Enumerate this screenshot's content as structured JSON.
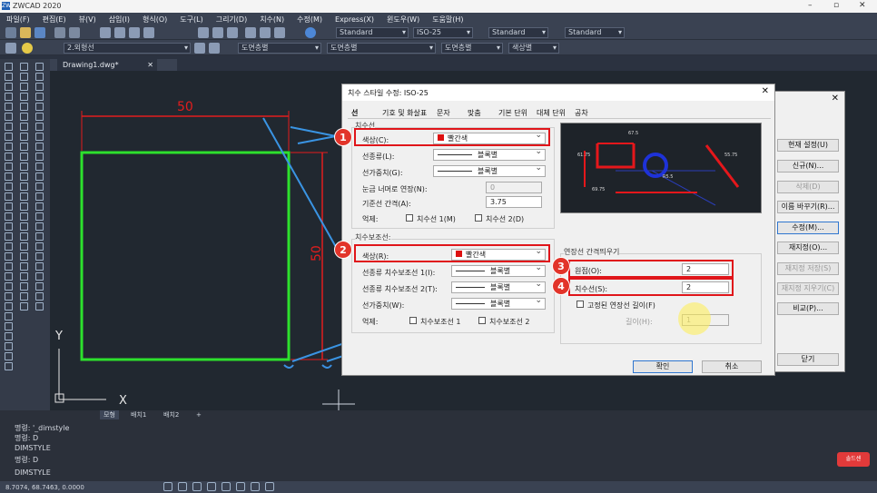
{
  "app": {
    "title": "ZWCAD 2020",
    "logo": "ZW"
  },
  "menu": [
    "파일(F)",
    "편집(E)",
    "뷰(V)",
    "삽입(I)",
    "형식(O)",
    "도구(L)",
    "그리기(D)",
    "치수(N)",
    "수정(M)",
    "Express(X)",
    "윈도우(W)",
    "도움말(H)"
  ],
  "toolbar": {
    "style1": "Standard",
    "style2": "ISO-25",
    "style3": "Standard",
    "style4": "Standard",
    "layer": "2.외형선",
    "color": "도면층별",
    "linetype": "도면층별",
    "lineweight": "도면층별",
    "plotstyle": "색상별"
  },
  "doc_tab": {
    "label": "Drawing1.dwg*"
  },
  "drawing": {
    "dim_top": "50",
    "dim_left": "50",
    "ucs_x": "X",
    "ucs_y": "Y"
  },
  "layout_tabs": [
    "모형",
    "배치1",
    "배치2",
    "+"
  ],
  "command_lines": [
    "명령: '_dimstyle",
    "명령: D",
    "DIMSTYLE",
    "명령: D",
    "DIMSTYLE"
  ],
  "coords": "8.7074, 68.7463, 0.0000",
  "dialog": {
    "title": "치수 스타일 수정: ISO-25",
    "tabs": [
      "선",
      "기호 및 화살표",
      "문자",
      "맞춤",
      "기본 단위",
      "대체 단위",
      "공차"
    ],
    "dimline": {
      "group": "치수선",
      "color_label": "색상(C):",
      "color_value": "빨간색",
      "linetype_label": "선종류(L):",
      "linetype_value": "블록별",
      "lineweight_label": "선가중치(G):",
      "lineweight_value": "블록별",
      "extend_label": "눈금 너머로 연장(N):",
      "extend_value": "0",
      "spacing_label": "기준선 간격(A):",
      "spacing_value": "3.75",
      "suppress_label": "억제:",
      "sup1": "치수선 1(M)",
      "sup2": "치수선 2(D)"
    },
    "extline": {
      "group": "치수보조선:",
      "color_label": "색상(R):",
      "color_value": "빨간색",
      "lt1_label": "선종류 치수보조선 1(I):",
      "lt1_value": "블록별",
      "lt2_label": "선종류 치수보조선 2(T):",
      "lt2_value": "블록별",
      "lw_label": "선가중치(W):",
      "lw_value": "블록별",
      "suppress_label": "억제:",
      "sup1": "치수보조선 1",
      "sup2": "치수보조선 2"
    },
    "offset": {
      "group": "연장선 간격띄우기",
      "origin_label": "원점(O):",
      "origin_value": "2",
      "dimline_label": "치수선(S):",
      "dimline_value": "2",
      "fixed_label": "고정된 연장선 길이(F)",
      "length_label": "길이(H):",
      "length_value": "1"
    },
    "preview": {
      "d1": "67.5",
      "d2": "61.75",
      "d3": "55.75",
      "d4": "R5.5",
      "d5": "69.75"
    },
    "ok": "확인",
    "cancel": "취소"
  },
  "side_dialog": {
    "buttons": [
      "현재 설정(U)",
      "신규(N)...",
      "삭제(D)",
      "이름 바꾸기(R)...",
      "수정(M)...",
      "재지정(O)...",
      "재지정 저장(S)",
      "재지정 지우기(C)",
      "비교(P)...",
      "닫기"
    ]
  },
  "steps": [
    "1",
    "2",
    "3",
    "4"
  ],
  "watermark": "솔드센"
}
